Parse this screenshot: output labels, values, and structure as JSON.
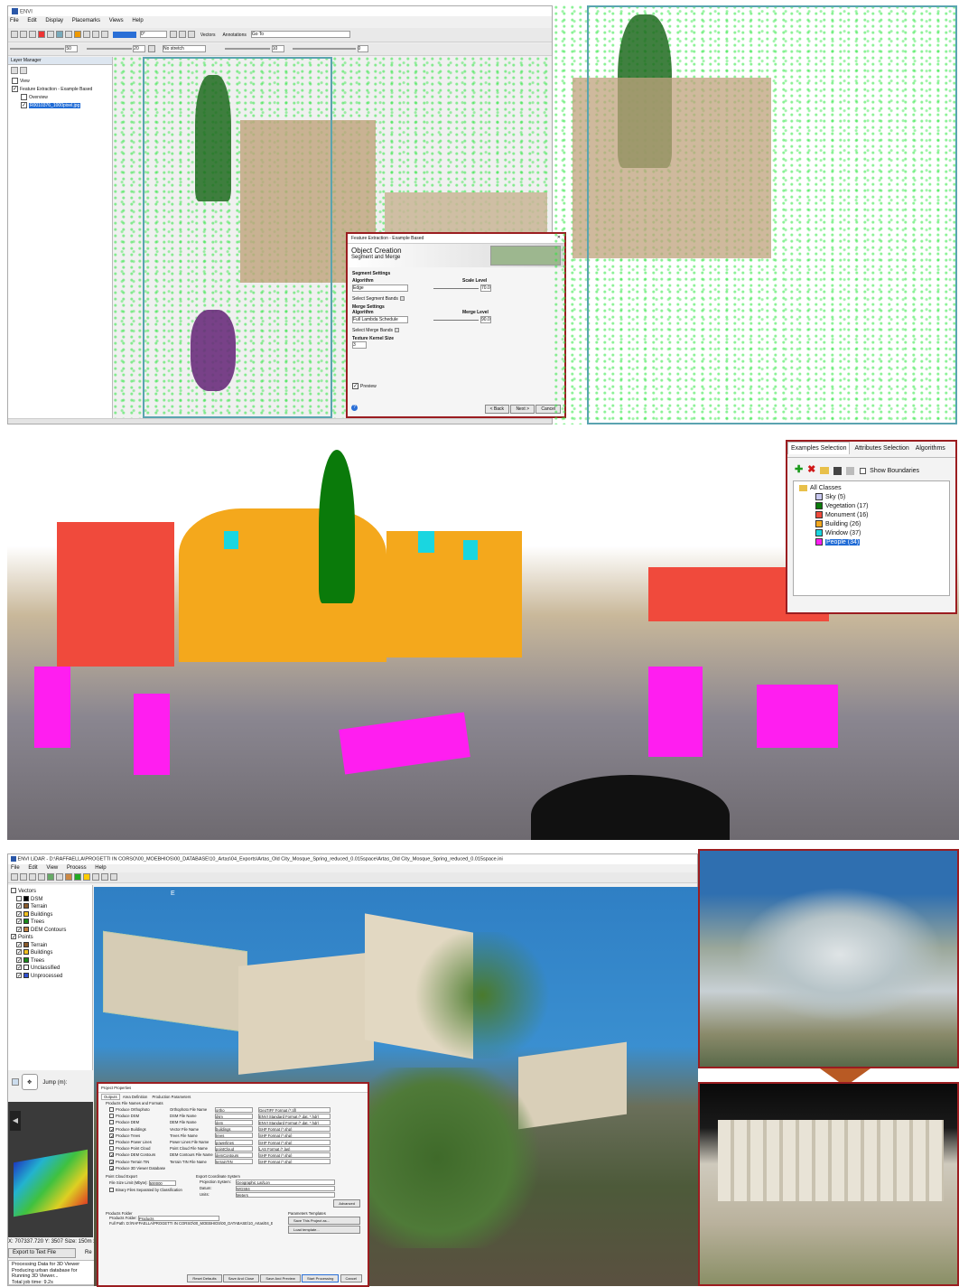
{
  "panel1": {
    "app_title": "ENVI",
    "menu": [
      "File",
      "Edit",
      "Display",
      "Placemarks",
      "Views",
      "Help"
    ],
    "toolbar": {
      "vectors": "Vectors",
      "annotations": "Annotations",
      "goto": "Go To",
      "angle": "0°",
      "zoom_val": "50",
      "stretch": "No stretch",
      "val20": "20",
      "val10": "10",
      "val0": "0"
    },
    "layer_manager": {
      "title": "Layer Manager",
      "items": [
        {
          "label": "View",
          "checked": false
        },
        {
          "label": "Feature Extraction - Example Based",
          "checked": true
        },
        {
          "label": "Overview",
          "checked": false
        },
        {
          "label": "R0010376_1000pixel.jpg",
          "checked": true,
          "selected": true
        }
      ]
    },
    "dialog": {
      "window_title": "Feature Extraction - Example Based",
      "heading": "Object Creation",
      "subheading": "Segment and Merge",
      "segment_settings": "Segment Settings",
      "algorithm": "Algorithm",
      "seg_algo": "Edge",
      "scale_level": "Scale Level",
      "scale_value": "70.0",
      "select_segment_bands": "Select Segment Bands",
      "merge_settings": "Merge Settings",
      "merge_algo": "Full Lambda Schedule",
      "merge_level": "Merge Level",
      "merge_value": "90.0",
      "select_merge_bands": "Select Merge Bands",
      "texture_kernel": "Texture Kernel Size",
      "texture_value": "3",
      "preview": "Preview",
      "back": "< Back",
      "next": "Next >",
      "cancel": "Cancel",
      "help": "?"
    }
  },
  "panel2": {
    "tabs": [
      "Examples Selection",
      "Attributes Selection",
      "Algorithms"
    ],
    "show_boundaries": "Show Boundaries",
    "root": "All Classes",
    "classes": [
      {
        "label": "Sky (5)",
        "color": "#c8c8f0"
      },
      {
        "label": "Vegetation (17)",
        "color": "#0a7a0a"
      },
      {
        "label": "Monument (16)",
        "color": "#f04a3c"
      },
      {
        "label": "Building (26)",
        "color": "#f4a81c"
      },
      {
        "label": "Window (37)",
        "color": "#1ad6e0"
      },
      {
        "label": "People (34)",
        "color": "#ff1ef0",
        "selected": true
      }
    ]
  },
  "panel3": {
    "title": "ENVI LiDAR - D:\\RAFFAELLA\\PROGETTI IN CORSO\\00_MOEBHIOS\\00_DATABASE\\10_Artas\\04_Exports\\Artas_Old City_Mosque_Spring_reduced_0.015space\\Artas_Old City_Mosque_Spring_reduced_0.015space.ini",
    "menu": [
      "File",
      "Edit",
      "View",
      "Process",
      "Help"
    ],
    "compass_label": "E",
    "tree": [
      {
        "label": "Vectors",
        "indent": 0,
        "checked": false
      },
      {
        "label": "DSM",
        "indent": 1,
        "checked": false,
        "color": "#000000"
      },
      {
        "label": "Terrain",
        "indent": 1,
        "checked": true,
        "color": "#8a5a2a"
      },
      {
        "label": "Buildings",
        "indent": 1,
        "checked": true,
        "color": "#f0c020"
      },
      {
        "label": "Trees",
        "indent": 1,
        "checked": true,
        "color": "#1a8a1a"
      },
      {
        "label": "DEM Contours",
        "indent": 1,
        "checked": true,
        "color": "#c08040"
      },
      {
        "label": "Points",
        "indent": 0,
        "checked": true
      },
      {
        "label": "Terrain",
        "indent": 1,
        "checked": true,
        "color": "#8a5a2a"
      },
      {
        "label": "Buildings",
        "indent": 1,
        "checked": true,
        "color": "#f0c020"
      },
      {
        "label": "Trees",
        "indent": 1,
        "checked": true,
        "color": "#1a8a1a"
      },
      {
        "label": "Unclassified",
        "indent": 1,
        "checked": true,
        "color": "#ffffff"
      },
      {
        "label": "Unprocessed",
        "indent": 1,
        "checked": true,
        "color": "#3050d0"
      }
    ],
    "jump": "Jump (m):",
    "status": "X: 707337.720 Y: 3507 Size: 150m x",
    "export": "Export to Text File",
    "re_btn": "Re",
    "log": [
      "Processing Data for 3D Viewer",
      "Producing urban database for",
      "Running 3D Viewer...",
      "Total job time: 9.2s"
    ],
    "dialog": {
      "title": "Project Properties",
      "tabs": [
        "Outputs",
        "Area Definition",
        "Production Parameters"
      ],
      "group": "Products File Names and Formats",
      "rows": [
        {
          "produce": "Produce Orthophoto",
          "name_label": "Orthophoto File Name",
          "name": "ortho",
          "format": "GeoTIFF Format (*.tif)",
          "checked": false
        },
        {
          "produce": "Produce DSM",
          "name_label": "DSM File Name",
          "name": "dsm",
          "format": "ENVI Standard Format (*.dat, *.hdr)",
          "checked": false
        },
        {
          "produce": "Produce DEM",
          "name_label": "DEM File Name",
          "name": "dem",
          "format": "ENVI Standard Format (*.dat, *.hdr)",
          "checked": false
        },
        {
          "produce": "Produce Buildings",
          "name_label": "Vector File Name",
          "name": "buildings",
          "format": "SHP Format (*.shp)",
          "checked": true
        },
        {
          "produce": "Produce Trees",
          "name_label": "Trees File Name",
          "name": "trees",
          "format": "SHP Format (*.shp)",
          "checked": true
        },
        {
          "produce": "Produce Power Lines",
          "name_label": "Power Lines File Name",
          "name": "powerlines",
          "format": "SHP Format (*.shp)",
          "checked": false
        },
        {
          "produce": "Produce Point Cloud",
          "name_label": "Point Cloud File Name",
          "name": "pointCloud",
          "format": "LAS Format (*.las)",
          "checked": false
        },
        {
          "produce": "Produce DEM Contours",
          "name_label": "DEM Contours File Name",
          "name": "demContours",
          "format": "SHP Format (*.shp)",
          "checked": true
        },
        {
          "produce": "Produce Terrain TIN",
          "name_label": "Terrain TIN File Name",
          "name": "terrainTIN",
          "format": "SHP Format (*.shp)",
          "checked": true
        },
        {
          "produce": "Produce 3D Viewer Database",
          "name_label": "",
          "name": "",
          "format": "",
          "checked": true
        }
      ],
      "point_cloud_export": "Point Cloud Export",
      "file_size_limit": "File Size Limit (Mbyte):",
      "file_size_value": "500000",
      "binary_files": "Binary Files Separated by Classification",
      "export_crs": "Export Coordinate System",
      "projection_label": "Projection System:",
      "projection_value": "Geographic Lat/Lon",
      "datum_label": "Datum:",
      "datum_value": "WGS84",
      "units_label": "Units:",
      "units_value": "Meters",
      "advanced": "Advanced",
      "products_folder_group": "Products Folder",
      "products_folder_label": "Products Folder:",
      "products_folder_value": "Products",
      "full_path": "Full Path: D:\\RAFFAELLA\\PROGETTI IN CORSO\\00_MOEBHIOS\\00_DATABASE\\10_Artas\\04_Exports\\Old City\\04_2aff",
      "param_templates": "Parameters Templates",
      "save_project": "Save This Project as...",
      "load_template": "Load template...",
      "buttons": [
        "Reset Defaults",
        "Save And Close",
        "Save And Preview",
        "Start Processing",
        "Cancel"
      ]
    }
  }
}
